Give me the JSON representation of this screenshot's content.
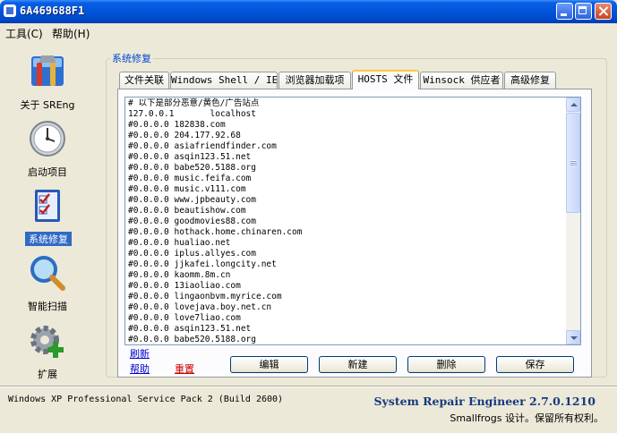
{
  "window": {
    "title": "6A469688F1"
  },
  "menu": {
    "tools": "工具(C)",
    "help": "帮助(H)"
  },
  "nav": {
    "about": "关于 SREng",
    "startup": "启动项目",
    "repair": "系统修复",
    "scan": "智能扫描",
    "extend": "扩展"
  },
  "group": {
    "label": "系统修复"
  },
  "tabs": [
    "文件关联",
    "Windows Shell / IE",
    "浏览器加载项",
    "HOSTS 文件",
    "Winsock 供应者",
    "高级修复"
  ],
  "active_tab": "HOSTS 文件",
  "hosts_lines": [
    "# 以下是部分恶意/黄色/广告站点",
    "127.0.0.1       localhost",
    "#0.0.0.0 182838.com",
    "#0.0.0.0 204.177.92.68",
    "#0.0.0.0 asiafriendfinder.com",
    "#0.0.0.0 asqin123.51.net",
    "#0.0.0.0 babe520.5188.org",
    "#0.0.0.0 music.feifa.com",
    "#0.0.0.0 music.v111.com",
    "#0.0.0.0 www.jpbeauty.com",
    "#0.0.0.0 beautishow.com",
    "#0.0.0.0 goodmovies88.com",
    "#0.0.0.0 hothack.home.chinaren.com",
    "#0.0.0.0 hualiao.net",
    "#0.0.0.0 iplus.allyes.com",
    "#0.0.0.0 jjkafei.longcity.net",
    "#0.0.0.0 kaomm.8m.cn",
    "#0.0.0.0 13iaoliao.com",
    "#0.0.0.0 lingaonbvm.myrice.com",
    "#0.0.0.0 lovejava.boy.net.cn",
    "#0.0.0.0 love7liao.com",
    "#0.0.0.0 asqin123.51.net",
    "#0.0.0.0 babe520.5188.org"
  ],
  "links": {
    "refresh": "刷新",
    "help": "帮助",
    "reset": "重置"
  },
  "buttons": {
    "edit": "编辑",
    "new": "新建",
    "delete": "删除",
    "save": "保存"
  },
  "status": {
    "os": "Windows XP Professional Service Pack 2 (Build 2600)",
    "product": "System Repair Engineer 2.7.0.1210",
    "copyright": "Smallfrogs 设计。保留所有权利。"
  },
  "colors": {
    "link": "#0000cc",
    "reset": "#cc0000",
    "selected": "#316ac5"
  }
}
